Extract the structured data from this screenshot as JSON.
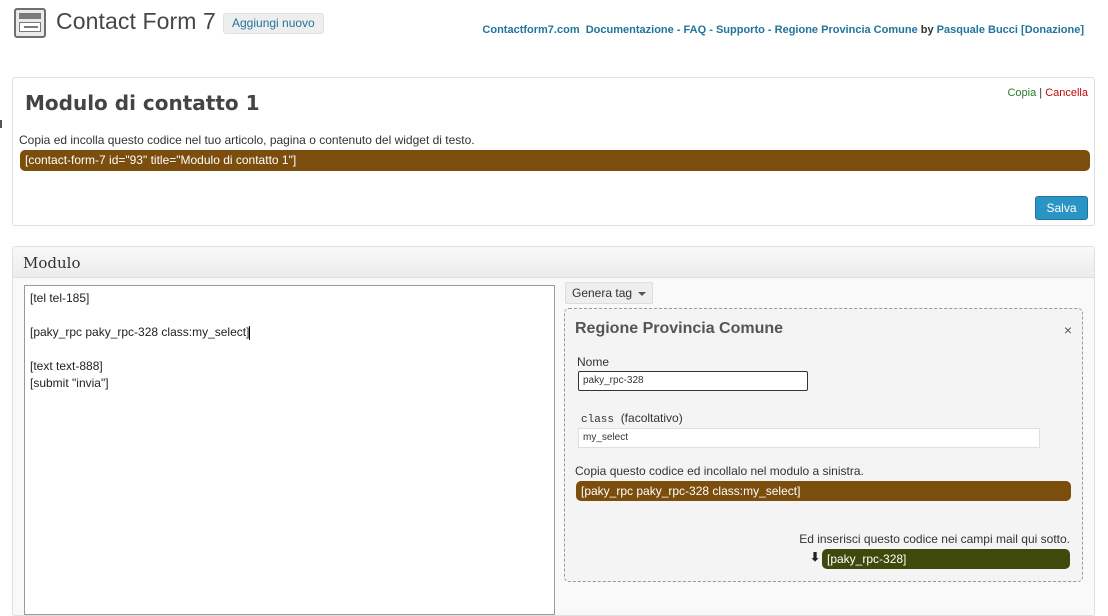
{
  "header": {
    "title": "Contact Form 7",
    "add_new": "Aggiungi nuovo",
    "links": {
      "site": "Contactform7.com",
      "docs": "Documentazione",
      "faq": "FAQ",
      "support": "Supporto",
      "plugin": "Regione Provincia Comune",
      "by": "by",
      "author": "Pasquale Bucci",
      "donate": "[Donazione]",
      "separator": "-"
    }
  },
  "contact_form": {
    "title": "Modulo di contatto 1",
    "copy_label": "Copia",
    "action_separator": "|",
    "delete_label": "Cancella",
    "shortcode_help": "Copia ed incolla questo codice nel tuo articolo, pagina o contenuto del widget di testo.",
    "shortcode": "[contact-form-7 id=\"93\" title=\"Modulo di contatto 1\"]",
    "save_label": "Salva"
  },
  "modulo": {
    "section_title": "Modulo",
    "form_lines": {
      "line1": "[tel tel-185]",
      "line2": "[paky_rpc paky_rpc-328 class:my_select]",
      "line3": "[text text-888]",
      "line4": "[submit \"invia\"]"
    },
    "generate_tag_label": "Genera tag",
    "tag_generator": {
      "title": "Regione Provincia Comune",
      "close_symbol": "×",
      "name_label": "Nome",
      "name_value": "paky_rpc-328",
      "class_code": "class",
      "class_optional": "(facoltativo)",
      "class_value": "my_select",
      "copy_help": "Copia questo codice ed incollalo nel modulo a sinistra.",
      "tag_code": "[paky_rpc paky_rpc-328 class:my_select]",
      "mail_help": "Ed inserisci questo codice nei campi mail qui sotto.",
      "arrow_symbol": "⬇",
      "mail_code": "[paky_rpc-328]"
    }
  },
  "colors": {
    "link": "#21759b",
    "shortcode_bg": "#7b4e0e",
    "mail_code_bg": "#3d4a0c",
    "save_bg": "#2a95c5",
    "copy": "#2b7a2b",
    "delete": "#bc0b0b"
  },
  "icons": {
    "plugin_icon": "form-icon",
    "dropdown": "caret-down-icon",
    "close": "close-icon",
    "arrow": "arrow-down-icon"
  }
}
